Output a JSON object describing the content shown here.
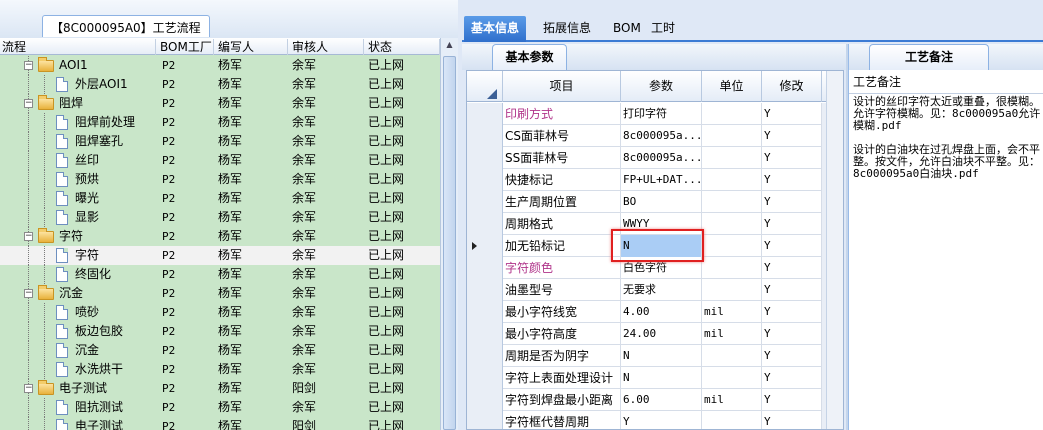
{
  "left": {
    "flow_tab_label": "【8C000095A0】工艺流程",
    "columns": [
      "流程",
      "BOM工厂",
      "编写人",
      "审核人",
      "状态"
    ],
    "rows": [
      {
        "level": 1,
        "type": "folder",
        "name": "AOI1",
        "bom": "P2",
        "author": "杨军",
        "reviewer": "余军",
        "status": "已上网"
      },
      {
        "level": 2,
        "type": "doc",
        "name": "外层AOI1",
        "bom": "P2",
        "author": "杨军",
        "reviewer": "余军",
        "status": "已上网"
      },
      {
        "level": 1,
        "type": "folder",
        "name": "阻焊",
        "bom": "P2",
        "author": "杨军",
        "reviewer": "余军",
        "status": "已上网"
      },
      {
        "level": 2,
        "type": "doc",
        "name": "阻焊前处理",
        "bom": "P2",
        "author": "杨军",
        "reviewer": "余军",
        "status": "已上网"
      },
      {
        "level": 2,
        "type": "doc",
        "name": "阻焊塞孔",
        "bom": "P2",
        "author": "杨军",
        "reviewer": "余军",
        "status": "已上网"
      },
      {
        "level": 2,
        "type": "doc",
        "name": "丝印",
        "bom": "P2",
        "author": "杨军",
        "reviewer": "余军",
        "status": "已上网"
      },
      {
        "level": 2,
        "type": "doc",
        "name": "预烘",
        "bom": "P2",
        "author": "杨军",
        "reviewer": "余军",
        "status": "已上网"
      },
      {
        "level": 2,
        "type": "doc",
        "name": "曝光",
        "bom": "P2",
        "author": "杨军",
        "reviewer": "余军",
        "status": "已上网"
      },
      {
        "level": 2,
        "type": "doc",
        "name": "显影",
        "bom": "P2",
        "author": "杨军",
        "reviewer": "余军",
        "status": "已上网"
      },
      {
        "level": 1,
        "type": "folder",
        "name": "字符",
        "bom": "P2",
        "author": "杨军",
        "reviewer": "余军",
        "status": "已上网"
      },
      {
        "level": 2,
        "type": "doc",
        "name": "字符",
        "bom": "P2",
        "author": "杨军",
        "reviewer": "余军",
        "status": "已上网",
        "selected": true
      },
      {
        "level": 2,
        "type": "doc",
        "name": "终固化",
        "bom": "P2",
        "author": "杨军",
        "reviewer": "余军",
        "status": "已上网"
      },
      {
        "level": 1,
        "type": "folder",
        "name": "沉金",
        "bom": "P2",
        "author": "杨军",
        "reviewer": "余军",
        "status": "已上网"
      },
      {
        "level": 2,
        "type": "doc",
        "name": "喷砂",
        "bom": "P2",
        "author": "杨军",
        "reviewer": "余军",
        "status": "已上网"
      },
      {
        "level": 2,
        "type": "doc",
        "name": "板边包胶",
        "bom": "P2",
        "author": "杨军",
        "reviewer": "余军",
        "status": "已上网"
      },
      {
        "level": 2,
        "type": "doc",
        "name": "沉金",
        "bom": "P2",
        "author": "杨军",
        "reviewer": "余军",
        "status": "已上网"
      },
      {
        "level": 2,
        "type": "doc",
        "name": "水洗烘干",
        "bom": "P2",
        "author": "杨军",
        "reviewer": "余军",
        "status": "已上网"
      },
      {
        "level": 1,
        "type": "folder",
        "name": "电子测试",
        "bom": "P2",
        "author": "杨军",
        "reviewer": "阳剑",
        "status": "已上网"
      },
      {
        "level": 2,
        "type": "doc",
        "name": "阻抗测试",
        "bom": "P2",
        "author": "杨军",
        "reviewer": "余军",
        "status": "已上网"
      },
      {
        "level": 2,
        "type": "doc",
        "name": "电子测试",
        "bom": "P2",
        "author": "杨军",
        "reviewer": "阳剑",
        "status": "已上网"
      }
    ]
  },
  "right": {
    "tabs": [
      "基本信息",
      "拓展信息",
      "BOM",
      "工时"
    ],
    "active_tab": 0,
    "subtab_label": "基本参数",
    "grid_columns": [
      "项目",
      "参数",
      "单位",
      "修改"
    ],
    "grid_rows": [
      {
        "item": "印刷方式",
        "param": "打印字符",
        "unit": "",
        "modified": "Y",
        "highlight": true
      },
      {
        "item": "CS面菲林号",
        "param": "8c000095a...",
        "unit": "",
        "modified": "Y"
      },
      {
        "item": "SS面菲林号",
        "param": "8c000095a...",
        "unit": "",
        "modified": "Y"
      },
      {
        "item": "快捷标记",
        "param": "FP+UL+DAT...",
        "unit": "",
        "modified": "Y"
      },
      {
        "item": "生产周期位置",
        "param": "BO",
        "unit": "",
        "modified": "Y"
      },
      {
        "item": "周期格式",
        "param": "WWYY",
        "unit": "",
        "modified": "Y"
      },
      {
        "item": "加无铅标记",
        "param": "N",
        "unit": "",
        "modified": "Y",
        "current": true
      },
      {
        "item": "字符颜色",
        "param": "白色字符",
        "unit": "",
        "modified": "Y",
        "highlight": true
      },
      {
        "item": "油墨型号",
        "param": "无要求",
        "unit": "",
        "modified": "Y"
      },
      {
        "item": "最小字符线宽",
        "param": "4.00",
        "unit": "mil",
        "modified": "Y"
      },
      {
        "item": "最小字符高度",
        "param": "24.00",
        "unit": "mil",
        "modified": "Y"
      },
      {
        "item": "周期是否为阴字",
        "param": "N",
        "unit": "",
        "modified": "Y"
      },
      {
        "item": "字符上表面处理设计",
        "param": "N",
        "unit": "",
        "modified": "Y"
      },
      {
        "item": "字符到焊盘最小距离",
        "param": "6.00",
        "unit": "mil",
        "modified": "Y"
      },
      {
        "item": "字符框代替周期",
        "param": "Y",
        "unit": "",
        "modified": "Y"
      }
    ],
    "notes": {
      "tab_label": "工艺备注",
      "title": "工艺备注",
      "body": "设计的丝印字符太近或重叠，很模糊。允许字符模糊。见：8c000095a0允许模糊.pdf\n\n设计的白油块在过孔焊盘上面，会不平整。按文件，允许白油块不平整。见：8c000095a0白油块.pdf"
    }
  }
}
